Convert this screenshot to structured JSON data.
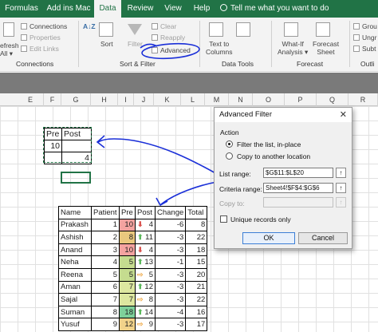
{
  "tabs": [
    "Formulas",
    "Add ins Mac",
    "Data",
    "Review",
    "View",
    "Help"
  ],
  "tell_me": "Tell me what you want to do",
  "ribbon": {
    "get_data": {
      "line1": "efresh",
      "line2": "All ▾"
    },
    "connections": {
      "items": [
        "Connections",
        "Properties",
        "Edit Links"
      ],
      "label": "Connections"
    },
    "sort_filter": {
      "sort_az": "A↓Z",
      "sort": "Sort",
      "filter": "Filter",
      "clear": "Clear",
      "reapply": "Reapply",
      "advanced": "Advanced",
      "label": "Sort & Filter"
    },
    "data_tools": {
      "text_to_columns": [
        "Text to",
        "Columns"
      ],
      "label": "Data Tools"
    },
    "forecast": {
      "what_if": [
        "What-If",
        "Analysis ▾"
      ],
      "forecast_sheet": [
        "Forecast",
        "Sheet"
      ],
      "label": "Forecast"
    },
    "outline": {
      "items": [
        "Grou",
        "Ungr",
        "Subt"
      ],
      "label": "Outli"
    }
  },
  "columns": [
    "E",
    "F",
    "G",
    "H",
    "I",
    "J",
    "K",
    "L",
    "M",
    "N",
    "O",
    "P",
    "Q",
    "R"
  ],
  "criteria_table": {
    "headers": [
      "Pre",
      "Post"
    ],
    "row1": [
      "10",
      ""
    ],
    "row2": [
      "",
      "4"
    ]
  },
  "data_table": {
    "headers": [
      "Name",
      "Patient",
      "Pre",
      "Post",
      "Change",
      "Total"
    ],
    "rows": [
      {
        "name": "Prakash",
        "patient": "1",
        "pre": "10",
        "arrow": "down",
        "post": "4",
        "change": "-6",
        "total": "8"
      },
      {
        "name": "Ashish",
        "patient": "2",
        "pre": "8",
        "arrow": "up",
        "post": "11",
        "change": "-3",
        "total": "22"
      },
      {
        "name": "Anand",
        "patient": "3",
        "pre": "10",
        "arrow": "down",
        "post": "4",
        "change": "-3",
        "total": "18"
      },
      {
        "name": "Neha",
        "patient": "4",
        "pre": "5",
        "arrow": "up",
        "post": "13",
        "change": "-1",
        "total": "15"
      },
      {
        "name": "Reena",
        "patient": "5",
        "pre": "5",
        "arrow": "right",
        "post": "5",
        "change": "-3",
        "total": "20"
      },
      {
        "name": "Aman",
        "patient": "6",
        "pre": "7",
        "arrow": "up",
        "post": "12",
        "change": "-3",
        "total": "21"
      },
      {
        "name": "Sajal",
        "patient": "7",
        "pre": "7",
        "arrow": "right",
        "post": "8",
        "change": "-3",
        "total": "22"
      },
      {
        "name": "Suman",
        "patient": "8",
        "pre": "18",
        "arrow": "up",
        "post": "14",
        "change": "-4",
        "total": "16"
      },
      {
        "name": "Yusuf",
        "patient": "9",
        "pre": "12",
        "arrow": "right",
        "post": "9",
        "change": "-3",
        "total": "17"
      }
    ]
  },
  "pre_colors": [
    "#f4a3a0",
    "#e9c87e",
    "#f4a3a0",
    "#c5dc8f",
    "#c5dc8f",
    "#dde7a0",
    "#dde7a0",
    "#7ed09a",
    "#f1d28a"
  ],
  "arrow_colors": {
    "up": "#5cb85c",
    "down": "#d9534f",
    "right": "#f0ad4e"
  },
  "dialog": {
    "title": "Advanced Filter",
    "close": "✕",
    "action_label": "Action",
    "option_in_place": "Filter the list, in-place",
    "option_copy": "Copy to another location",
    "list_range_label": "List range:",
    "list_range_value": "$G$11:$L$20",
    "criteria_range_label": "Criteria range:",
    "criteria_range_value": "Sheet4!$F$4:$G$6",
    "copy_to_label": "Copy to:",
    "unique_label": "Unique records only",
    "ok": "OK",
    "cancel": "Cancel",
    "ref_icon": "↑"
  },
  "colors": {
    "excel_green": "#217346",
    "annotation_blue": "#1a2fd8"
  }
}
